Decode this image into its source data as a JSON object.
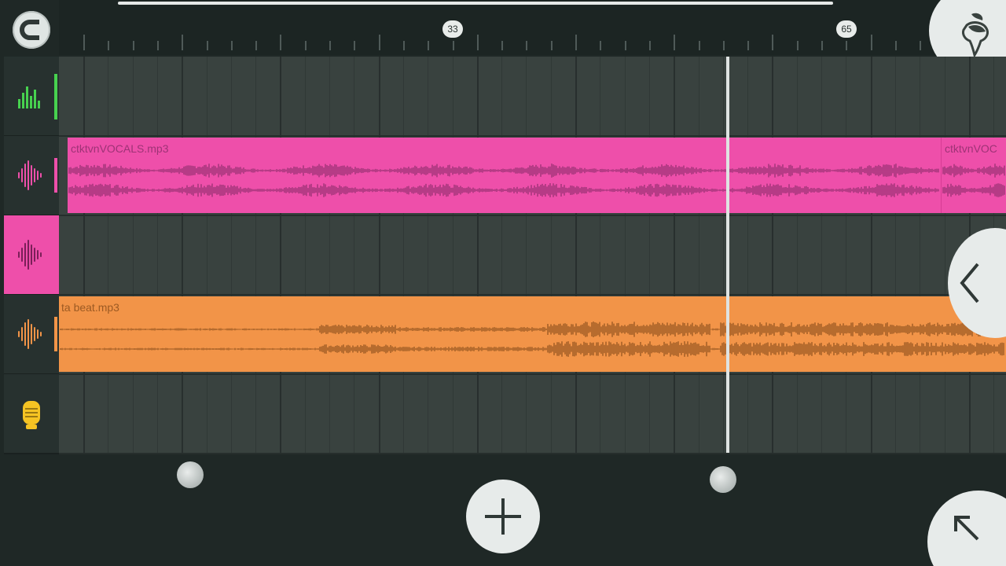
{
  "timeline": {
    "bar_marker_1": "33",
    "bar_marker_2": "65"
  },
  "tracks": [
    {
      "icon": "mixer-levels-icon",
      "accent": "#47d14f"
    },
    {
      "icon": "waveform-icon",
      "accent": "#ee4faa"
    },
    {
      "icon": "waveform-icon",
      "accent": "#ee4faa",
      "selected": true
    },
    {
      "icon": "waveform-icon",
      "accent": "#f29448"
    },
    {
      "icon": "microphone-icon",
      "accent": "#f5c323"
    }
  ],
  "clips": {
    "vocals_name": "ctktvnVOCALS.mp3",
    "vocals_name_repeat": "ctktvnVOC",
    "beat_name": "ta beat.mp3"
  },
  "colors": {
    "vocals_clip": "#ee4faa",
    "vocals_wave": "#9e3376",
    "beat_clip": "#f29448",
    "beat_wave": "#9c5a23",
    "background": "#1f2826",
    "lane": "#39423f"
  },
  "icons": {
    "magnet": "magnet-snap-icon",
    "logo": "fl-fruit-logo-icon",
    "add": "plus-icon",
    "collapse": "chevron-left-icon",
    "expand": "arrow-up-left-icon"
  }
}
